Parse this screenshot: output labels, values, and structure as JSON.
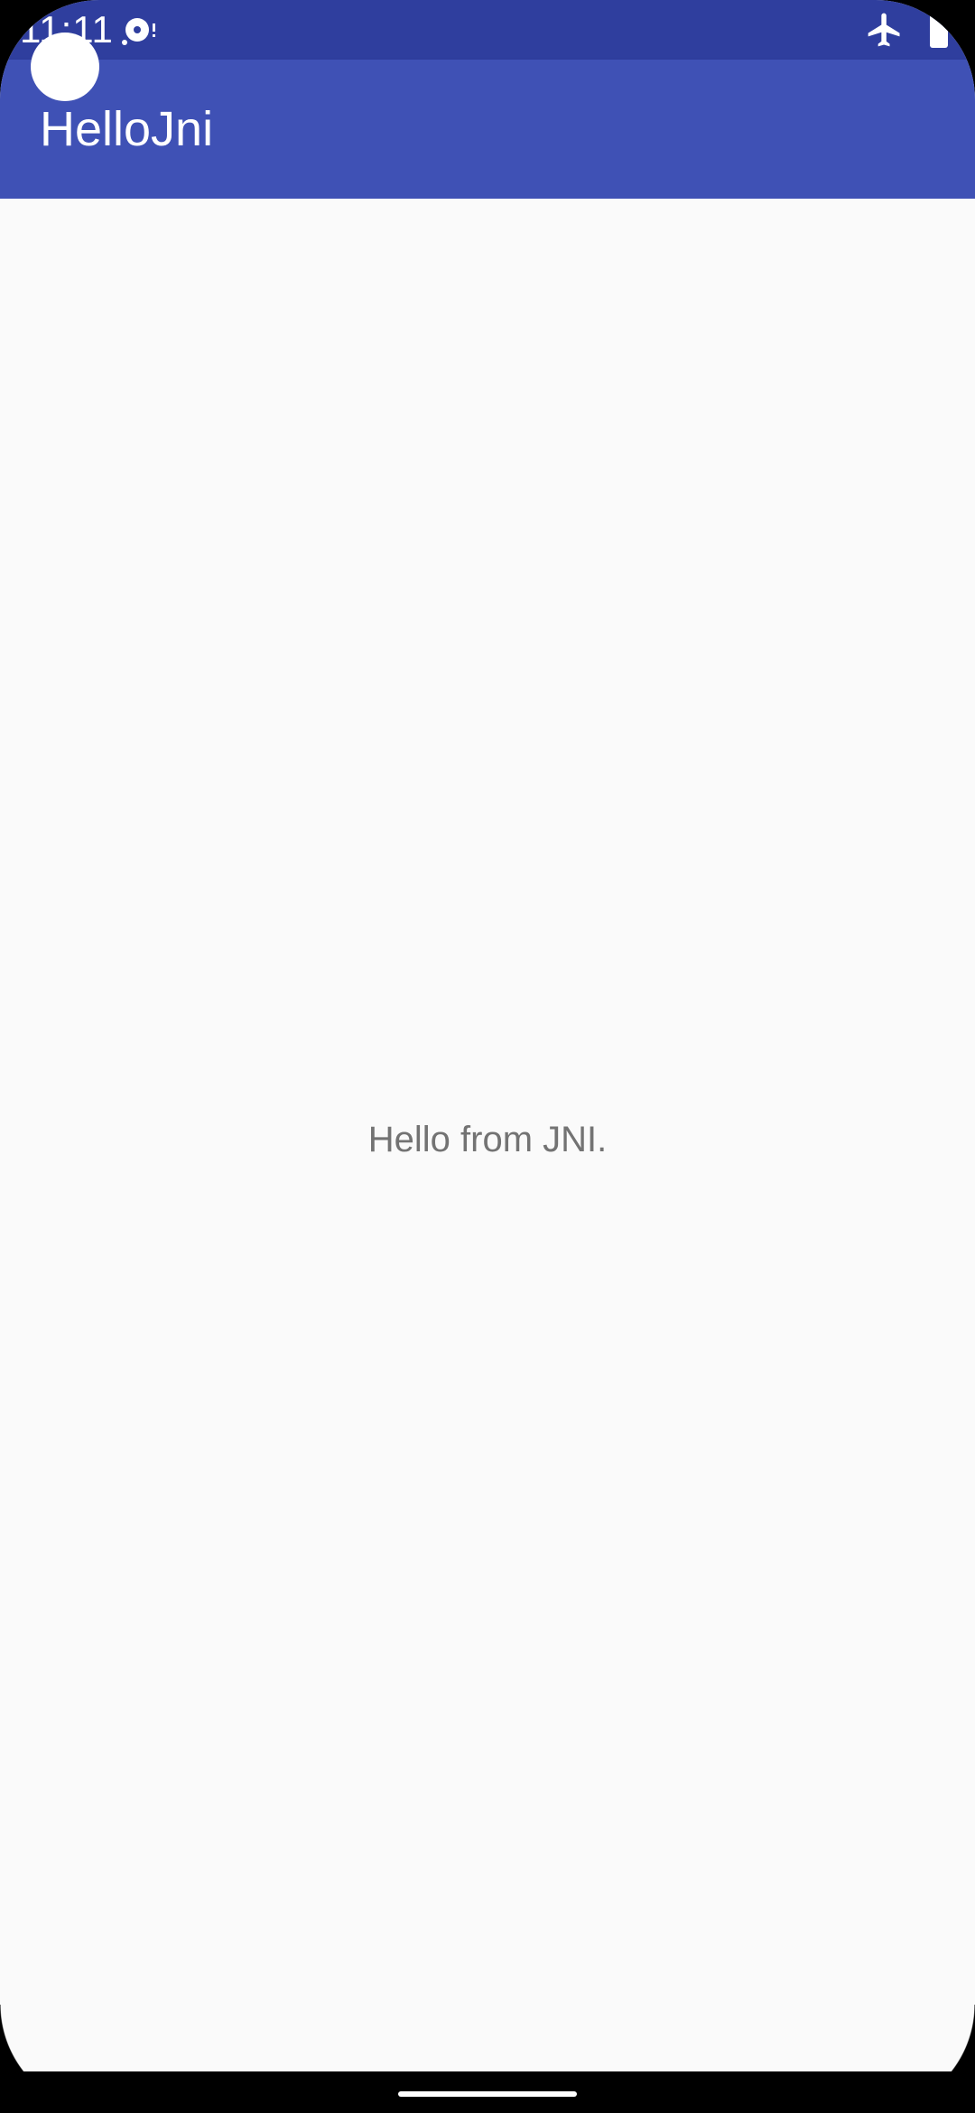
{
  "status_bar": {
    "time": "11:11",
    "icons": [
      "sync-icon",
      "airplane-mode-icon",
      "battery-icon"
    ]
  },
  "app_bar": {
    "title": "HelloJni"
  },
  "main": {
    "message": "Hello from JNI."
  },
  "colors": {
    "status_bar": "#2f3e9e",
    "app_bar": "#3f51b5",
    "background": "#fafafa",
    "message_text": "#737373"
  }
}
